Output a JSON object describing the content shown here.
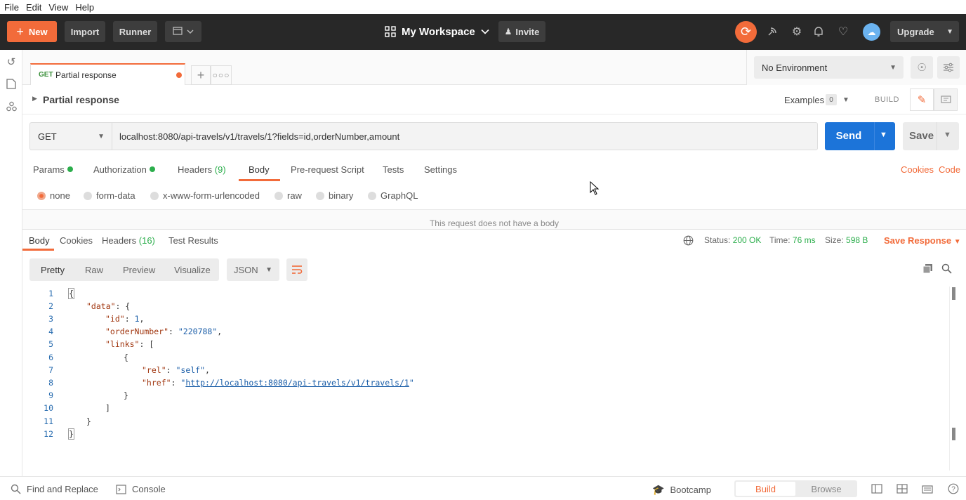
{
  "menubar": {
    "items": [
      "File",
      "Edit",
      "View",
      "Help"
    ]
  },
  "header": {
    "new_label": "New",
    "import_label": "Import",
    "runner_label": "Runner",
    "workspace_label": "My Workspace",
    "invite_label": "Invite",
    "upgrade_label": "Upgrade",
    "icons": [
      "sync-icon",
      "satellite-icon",
      "settings-gear-icon",
      "bell-icon",
      "heart-icon",
      "cloud-icon"
    ],
    "accent": "#f26b3a",
    "bg": "#282828"
  },
  "sidebar": {
    "icons": [
      "history-icon",
      "collections-icon",
      "apis-icon"
    ]
  },
  "tabs": {
    "active": {
      "method": "GET",
      "title": "Partial response",
      "unsaved": true
    }
  },
  "environment": {
    "selected": "No Environment"
  },
  "request": {
    "name": "Partial response",
    "examples_label": "Examples",
    "examples_count": "0",
    "build_label": "BUILD",
    "method": "GET",
    "url": "localhost:8080/api-travels/v1/travels/1?fields=id,orderNumber,amount",
    "send_label": "Send",
    "save_label": "Save",
    "tabs": {
      "params": "Params",
      "authorization": "Authorization",
      "headers": "Headers",
      "headers_count": "(9)",
      "body": "Body",
      "prerequest": "Pre-request Script",
      "tests": "Tests",
      "settings": "Settings"
    },
    "cookies_link": "Cookies",
    "code_link": "Code",
    "body_types": [
      "none",
      "form-data",
      "x-www-form-urlencoded",
      "raw",
      "binary",
      "GraphQL"
    ],
    "body_type_selected": "none",
    "no_body_message": "This request does not have a body"
  },
  "response": {
    "tabs": {
      "body": "Body",
      "cookies": "Cookies",
      "headers": "Headers",
      "headers_count": "(16)",
      "test_results": "Test Results"
    },
    "status_label": "Status:",
    "status_value": "200 OK",
    "time_label": "Time:",
    "time_value": "76 ms",
    "size_label": "Size:",
    "size_value": "598 B",
    "save_response_label": "Save Response",
    "views": [
      "Pretty",
      "Raw",
      "Preview",
      "Visualize"
    ],
    "view_selected": "Pretty",
    "language": "JSON",
    "line_numbers": [
      "1",
      "2",
      "3",
      "4",
      "5",
      "6",
      "7",
      "8",
      "9",
      "10",
      "11",
      "12"
    ],
    "code": {
      "l1": "{",
      "l2_key": "\"data\"",
      "l2_rest": ": {",
      "l3_key": "\"id\"",
      "l3_val": "1",
      "l4_key": "\"orderNumber\"",
      "l4_val": "\"220788\"",
      "l5_key": "\"links\"",
      "l5_rest": ": [",
      "l6": "{",
      "l7_key": "\"rel\"",
      "l7_val": "\"self\"",
      "l8_key": "\"href\"",
      "l8_val": "http://localhost:8080/api-travels/v1/travels/1",
      "l9": "}",
      "l10": "]",
      "l11": "}",
      "l12": "}"
    }
  },
  "statusbar": {
    "find_replace": "Find and Replace",
    "console": "Console",
    "bootcamp": "Bootcamp",
    "build": "Build",
    "browse": "Browse"
  }
}
